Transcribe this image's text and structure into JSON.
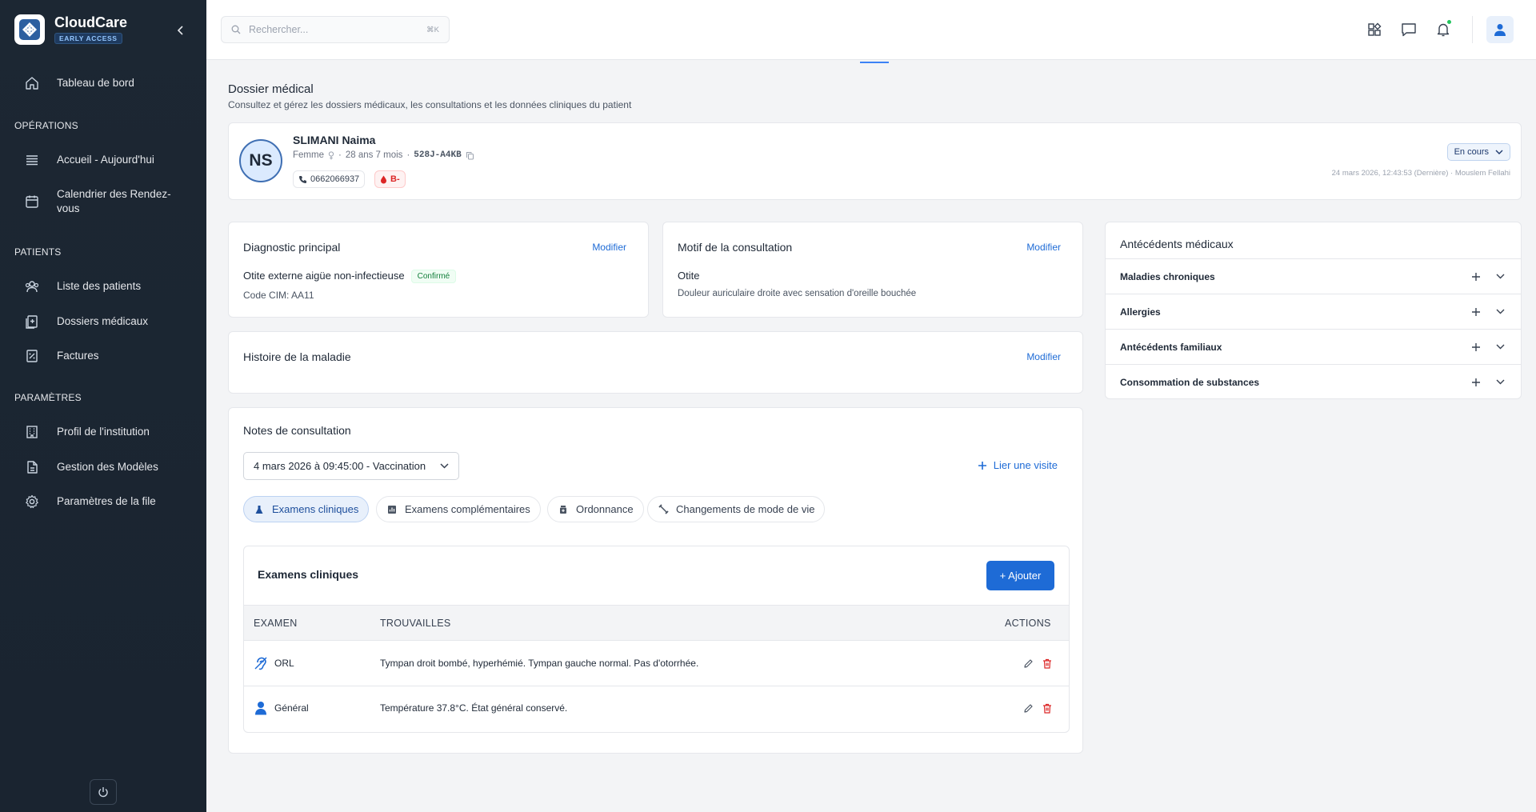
{
  "brand": {
    "name": "CloudCare",
    "badge": "EARLY ACCESS"
  },
  "sidebar": {
    "home": "Tableau de bord",
    "sections": {
      "operations": "OPÉRATIONS",
      "patients": "PATIENTS",
      "parametres": "PARAMÈTRES"
    },
    "items": {
      "accueil": "Accueil - Aujourd'hui",
      "calendrier": "Calendrier des Rendez-vous",
      "liste_patients": "Liste des patients",
      "dossiers": "Dossiers médicaux",
      "factures": "Factures",
      "profil": "Profil de l'institution",
      "modeles": "Gestion des Modèles",
      "file": "Paramètres de la file"
    }
  },
  "search": {
    "placeholder": "Rechercher...",
    "shortcut": "⌘K"
  },
  "page": {
    "title": "Dossier médical",
    "subtitle": "Consultez et gérez les dossiers médicaux, les consultations et les données cliniques du patient"
  },
  "patient": {
    "initials": "NS",
    "name": "SLIMANI Naima",
    "gender": "Femme",
    "age": "28 ans 7 mois",
    "id": "528J-A4KB",
    "phone": "0662066937",
    "blood": "B-",
    "status": "En cours",
    "last_update": "24 mars 2026, 12:43:53 (Dernière) · Mouslem Fellahi"
  },
  "diagnostic": {
    "title": "Diagnostic principal",
    "edit": "Modifier",
    "name": "Otite externe aigüe non-infectieuse",
    "badge": "Confirmé",
    "code": "Code CIM: AA11"
  },
  "motif": {
    "title": "Motif de la consultation",
    "edit": "Modifier",
    "name": "Otite",
    "desc": "Douleur auriculaire droite avec sensation d'oreille bouchée"
  },
  "histoire": {
    "title": "Histoire de la maladie",
    "edit": "Modifier"
  },
  "antecedents": {
    "title": "Antécédents médicaux",
    "items": [
      "Maladies chroniques",
      "Allergies",
      "Antécédents familiaux",
      "Consommation de substances"
    ]
  },
  "notes": {
    "title": "Notes de consultation",
    "selected_visit": "4 mars 2026 à 09:45:00 - Vaccination",
    "link_visit": "Lier une visite",
    "tabs": [
      "Examens cliniques",
      "Examens complémentaires",
      "Ordonnance",
      "Changements de mode de vie"
    ],
    "section_title": "Examens cliniques",
    "add": "+ Ajouter",
    "columns": [
      "EXAMEN",
      "TROUVAILLES",
      "ACTIONS"
    ],
    "rows": [
      {
        "exam": "ORL",
        "finding": "Tympan droit bombé, hyperhémié. Tympan gauche normal. Pas d'otorrhée.",
        "icon": "ear-icon"
      },
      {
        "exam": "Général",
        "finding": "Température 37.8°C. État général conservé.",
        "icon": "person-icon"
      }
    ]
  },
  "colors": {
    "accent": "#1e6bd6",
    "sidebar": "#1c2733",
    "danger": "#dc2626",
    "success": "#15803d"
  }
}
